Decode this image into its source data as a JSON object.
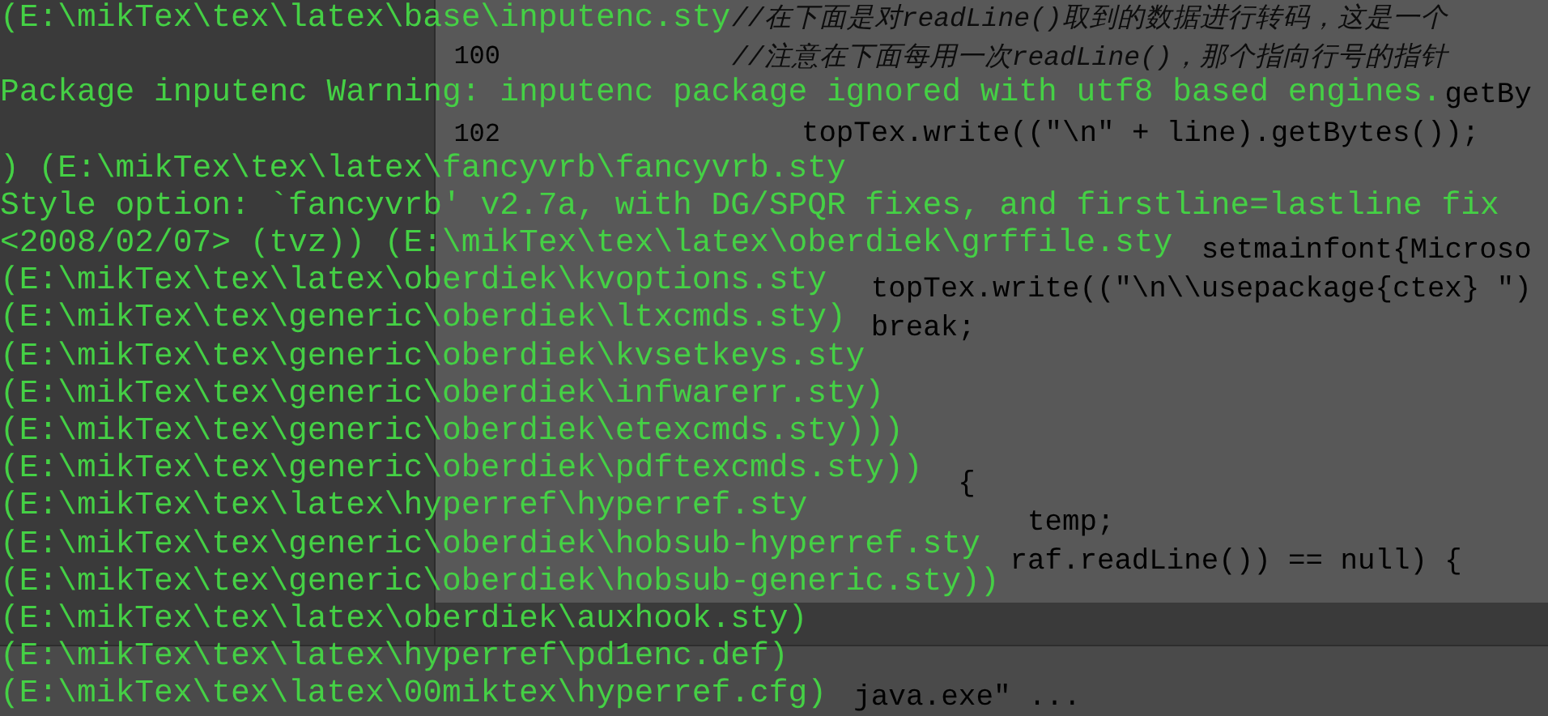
{
  "editor": {
    "lines": [
      {
        "kind": "comment",
        "text": "//在下面是对readLine()取到的数据进行转码，这是一个"
      },
      {
        "kind": "comment",
        "number": "100",
        "text": "//注意在下面每用一次readLine()，那个指向行号的指针"
      },
      {
        "kind": "code",
        "text": "                                         getBy"
      },
      {
        "kind": "code",
        "number": "102",
        "text": "    topTex.write((\"\\n\" + line).getBytes());"
      },
      {
        "kind": "blank"
      },
      {
        "kind": "blank"
      },
      {
        "kind": "code",
        "text": "                           setmainfont{Microso"
      },
      {
        "kind": "code",
        "text": "        topTex.write((\"\\n\\\\usepackage{ctex} \")"
      },
      {
        "kind": "code",
        "text": "        break;"
      },
      {
        "kind": "blank"
      },
      {
        "kind": "blank"
      },
      {
        "kind": "blank"
      },
      {
        "kind": "code",
        "text": "             {"
      },
      {
        "kind": "code",
        "text": "                 temp;"
      },
      {
        "kind": "code",
        "text": "                raf.readLine()) == null) {"
      }
    ]
  },
  "run_panel": {
    "command": "                                        java.exe\" ..."
  },
  "console": {
    "lines": [
      {
        "kind": "text",
        "text": "(E:\\mikTex\\tex\\latex\\base\\inputenc.sty"
      },
      {
        "kind": "blank"
      },
      {
        "kind": "text",
        "text": "Package inputenc Warning: inputenc package ignored with utf8 based engines."
      },
      {
        "kind": "blank"
      },
      {
        "kind": "text",
        "text": ") (E:\\mikTex\\tex\\latex\\fancyvrb\\fancyvrb.sty"
      },
      {
        "kind": "text",
        "text": "Style option: `fancyvrb' v2.7a, with DG/SPQR fixes, and firstline=lastline fix"
      },
      {
        "kind": "text",
        "text": "<2008/02/07> (tvz)) (E:\\mikTex\\tex\\latex\\oberdiek\\grffile.sty"
      },
      {
        "kind": "text",
        "text": "(E:\\mikTex\\tex\\latex\\oberdiek\\kvoptions.sty"
      },
      {
        "kind": "text",
        "text": "(E:\\mikTex\\tex\\generic\\oberdiek\\ltxcmds.sty)"
      },
      {
        "kind": "text",
        "text": "(E:\\mikTex\\tex\\generic\\oberdiek\\kvsetkeys.sty"
      },
      {
        "kind": "text",
        "text": "(E:\\mikTex\\tex\\generic\\oberdiek\\infwarerr.sty)"
      },
      {
        "kind": "text",
        "text": "(E:\\mikTex\\tex\\generic\\oberdiek\\etexcmds.sty)))"
      },
      {
        "kind": "text",
        "text": "(E:\\mikTex\\tex\\generic\\oberdiek\\pdftexcmds.sty))"
      },
      {
        "kind": "text",
        "text": "(E:\\mikTex\\tex\\latex\\hyperref\\hyperref.sty"
      },
      {
        "kind": "text",
        "text": "(E:\\mikTex\\tex\\generic\\oberdiek\\hobsub-hyperref.sty"
      },
      {
        "kind": "text",
        "text": "(E:\\mikTex\\tex\\generic\\oberdiek\\hobsub-generic.sty))"
      },
      {
        "kind": "text",
        "text": "(E:\\mikTex\\tex\\latex\\oberdiek\\auxhook.sty)"
      },
      {
        "kind": "text",
        "text": "(E:\\mikTex\\tex\\latex\\hyperref\\pd1enc.def)"
      },
      {
        "kind": "text",
        "text": "(E:\\mikTex\\tex\\latex\\00miktex\\hyperref.cfg)"
      }
    ]
  }
}
